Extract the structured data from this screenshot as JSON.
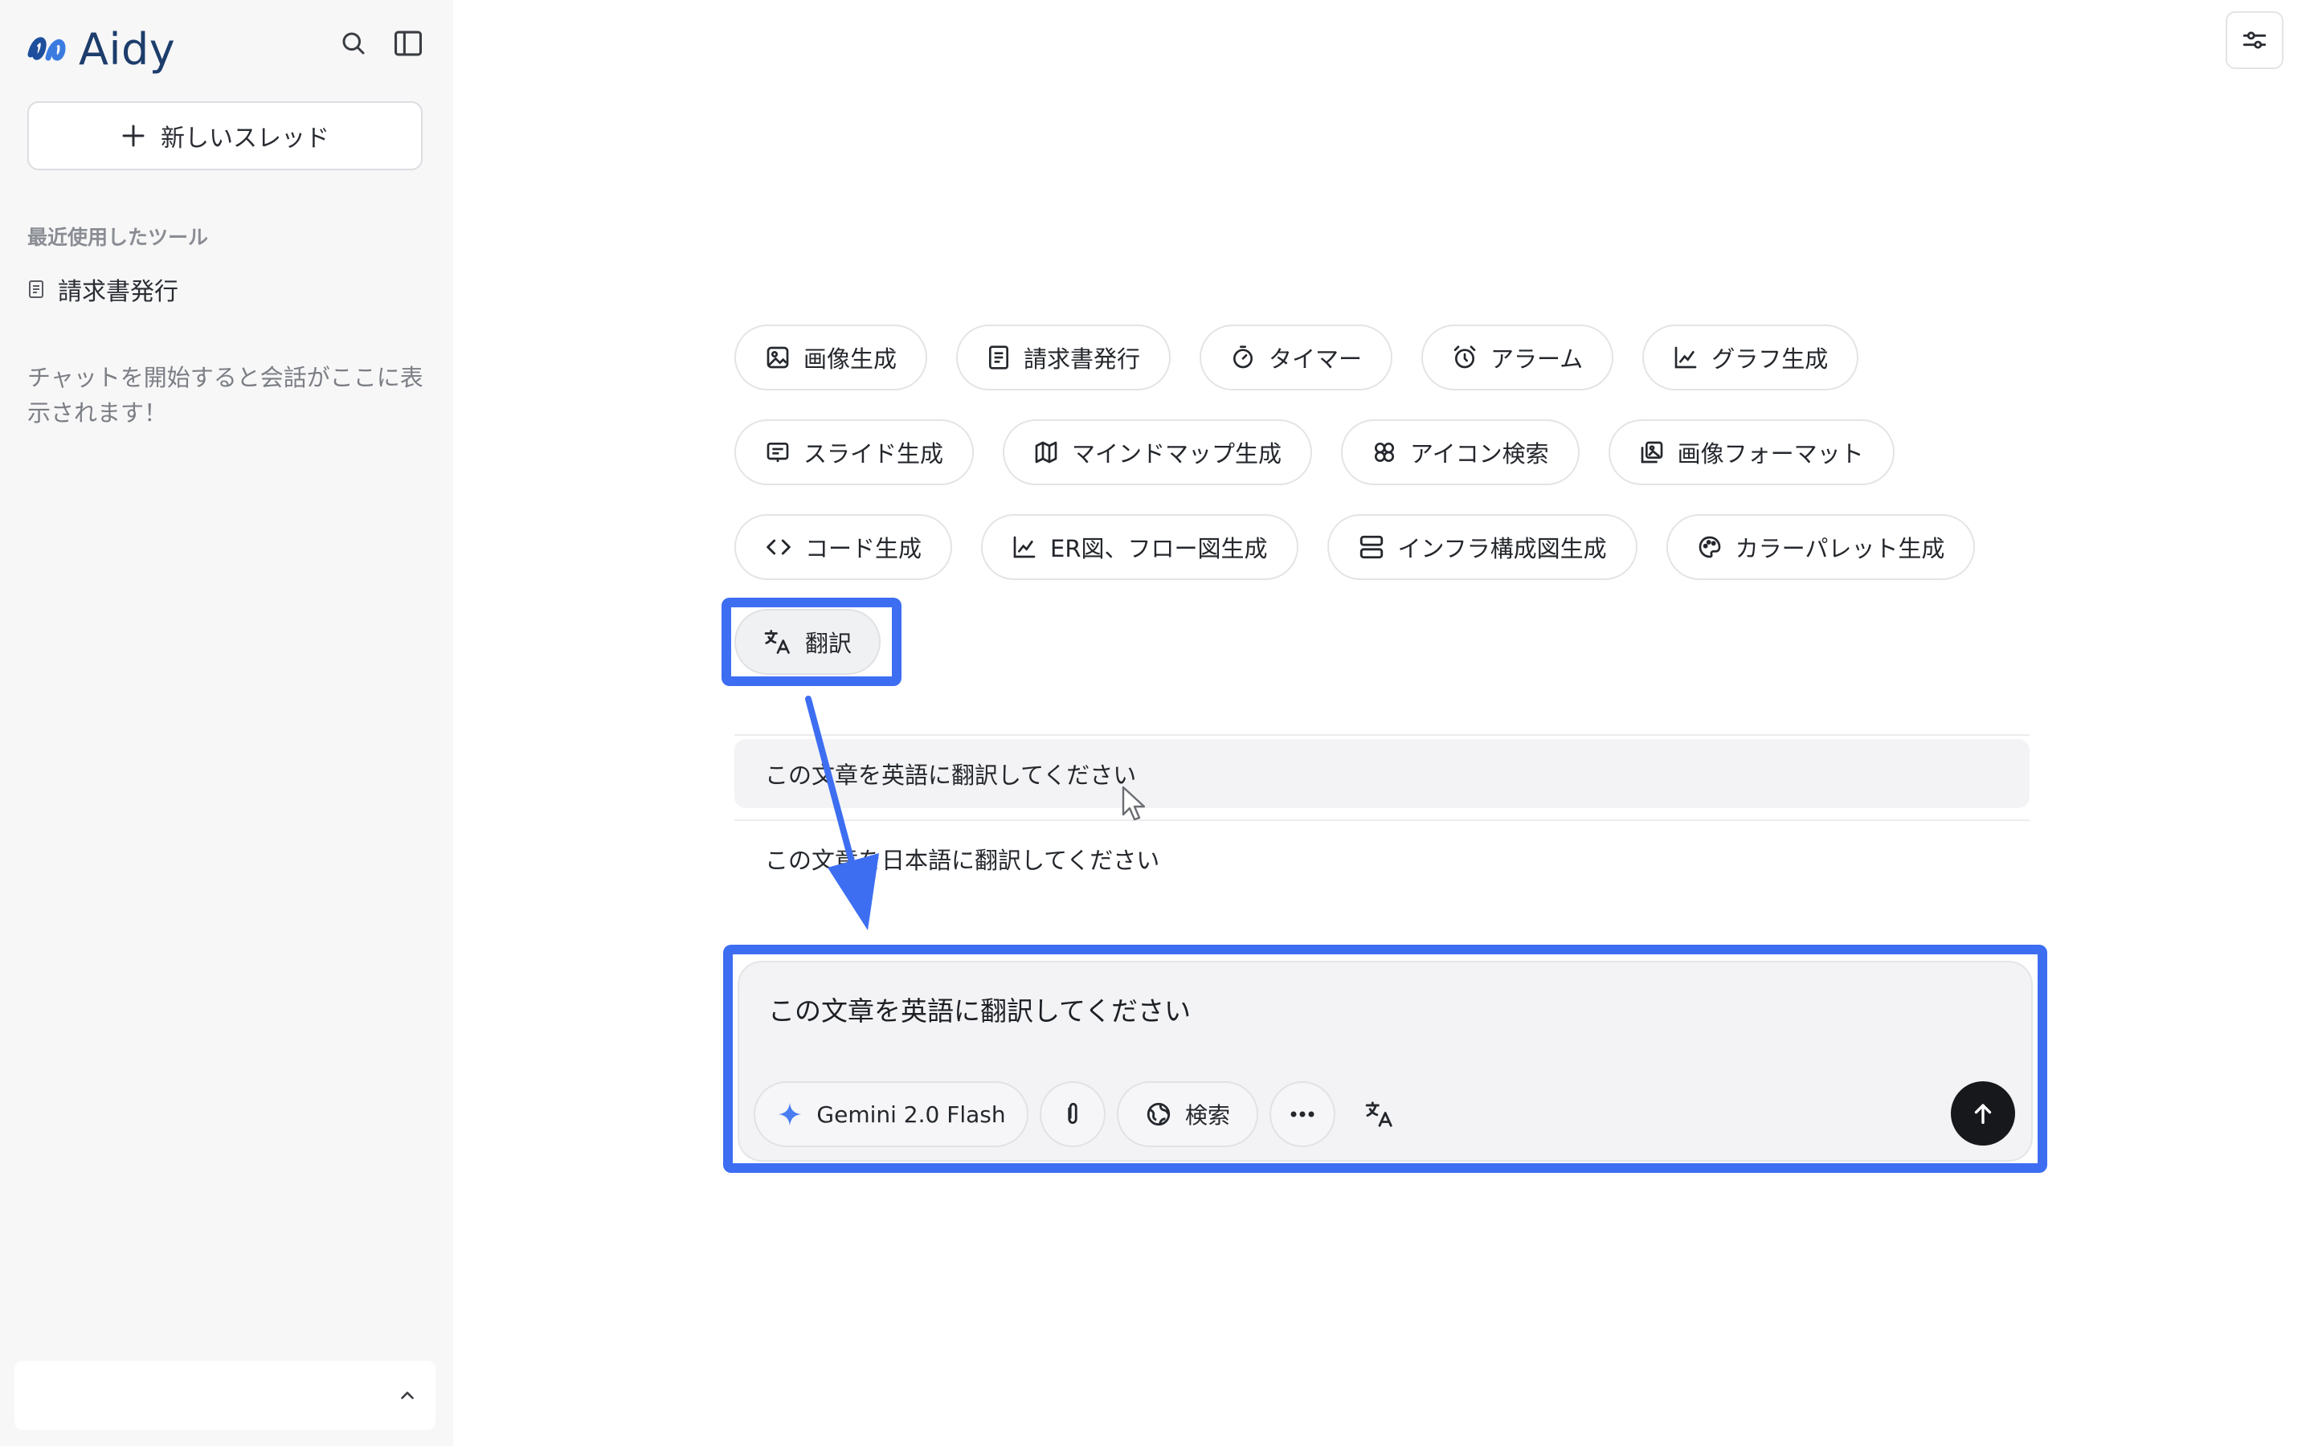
{
  "app": {
    "name": "Aidy",
    "brand_color": "#1d3d6b",
    "highlight_color": "#3d6ef2"
  },
  "sidebar": {
    "new_thread_label": "新しいスレッド",
    "recent_label": "最近使用したツール",
    "recent_items": [
      {
        "label": "請求書発行",
        "icon": "document-icon"
      }
    ],
    "empty_note": "チャットを開始すると会話がここに表示されます！"
  },
  "tools": {
    "rows": [
      [
        {
          "label": "画像生成",
          "icon": "image-icon"
        },
        {
          "label": "請求書発行",
          "icon": "document-icon"
        },
        {
          "label": "タイマー",
          "icon": "timer-icon"
        },
        {
          "label": "アラーム",
          "icon": "alarm-icon"
        },
        {
          "label": "グラフ生成",
          "icon": "chart-icon"
        }
      ],
      [
        {
          "label": "スライド生成",
          "icon": "slides-icon"
        },
        {
          "label": "マインドマップ生成",
          "icon": "map-icon"
        },
        {
          "label": "アイコン検索",
          "icon": "icon-search-icon"
        },
        {
          "label": "画像フォーマット",
          "icon": "image-format-icon"
        }
      ],
      [
        {
          "label": "コード生成",
          "icon": "code-icon"
        },
        {
          "label": "ER図、フロー図生成",
          "icon": "chart-icon"
        },
        {
          "label": "インフラ構成図生成",
          "icon": "server-icon"
        },
        {
          "label": "カラーパレット生成",
          "icon": "palette-icon"
        }
      ],
      [
        {
          "label": "翻訳",
          "icon": "translate-icon",
          "active": true
        }
      ]
    ]
  },
  "suggestions": [
    "この文章を英語に翻訳してください",
    "この文章を日本語に翻訳してください"
  ],
  "composer": {
    "text": "この文章を英語に翻訳してください",
    "model_label": "Gemini 2.0 Flash",
    "search_label": "検索"
  }
}
